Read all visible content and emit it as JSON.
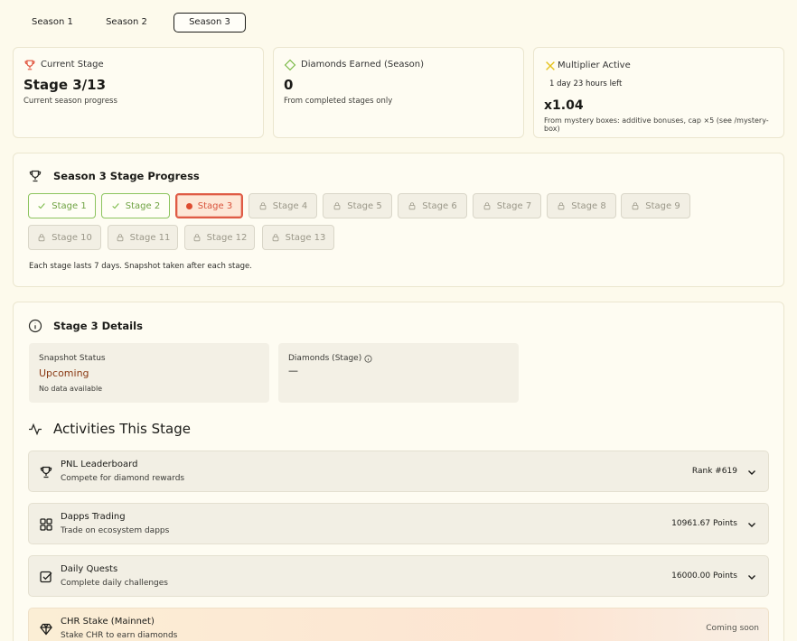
{
  "season_tabs": [
    "Season 1",
    "Season 2",
    "Season 3"
  ],
  "stats": {
    "current_stage": {
      "label": "Current Stage",
      "value": "Stage 3/13",
      "sub": "Current season progress",
      "icon": "trophy-icon",
      "color": "#e0513b"
    },
    "diamonds": {
      "label": "Diamonds Earned (Season)",
      "value": "0",
      "sub": "From completed stages only",
      "icon": "diamond-icon",
      "color": "#7dbb4b"
    },
    "multiplier": {
      "label": "Multiplier Active",
      "time_left": "1 day 23 hours left",
      "value": "x1.04",
      "sub": "From mystery boxes: additive bonuses, cap ×5 (see /mystery-box)",
      "icon": "sparkle-icon",
      "color": "#e6c21c"
    }
  },
  "progress": {
    "title": "Season 3 Stage Progress",
    "stages": [
      {
        "label": "Stage 1",
        "state": "done"
      },
      {
        "label": "Stage 2",
        "state": "done"
      },
      {
        "label": "Stage 3",
        "state": "current"
      },
      {
        "label": "Stage 4",
        "state": "locked"
      },
      {
        "label": "Stage 5",
        "state": "locked"
      },
      {
        "label": "Stage 6",
        "state": "locked"
      },
      {
        "label": "Stage 7",
        "state": "locked"
      },
      {
        "label": "Stage 8",
        "state": "locked"
      },
      {
        "label": "Stage 9",
        "state": "locked"
      },
      {
        "label": "Stage 10",
        "state": "locked"
      },
      {
        "label": "Stage 11",
        "state": "locked"
      },
      {
        "label": "Stage 12",
        "state": "locked"
      },
      {
        "label": "Stage 13",
        "state": "locked"
      }
    ],
    "note": "Each stage lasts 7 days. Snapshot taken after each stage."
  },
  "details": {
    "title": "Stage 3 Details",
    "snapshot": {
      "label": "Snapshot Status",
      "value": "Upcoming",
      "note": "No data available",
      "value_color": "#8a3a14"
    },
    "diamonds_stage": {
      "label": "Diamonds (Stage)",
      "value": "—"
    }
  },
  "activities": {
    "title": "Activities This Stage",
    "items": [
      {
        "title": "PNL Leaderboard",
        "sub": "Compete for diamond rewards",
        "value": "Rank #619",
        "icon": "trophy-icon"
      },
      {
        "title": "Dapps Trading",
        "sub": "Trade on ecosystem dapps",
        "value": "10961.67 Points",
        "icon": "grid-icon"
      },
      {
        "title": "Daily Quests",
        "sub": "Complete daily challenges",
        "value": "16000.00 Points",
        "icon": "checkbox-icon"
      },
      {
        "title": "CHR Stake (Mainnet)",
        "sub": "Stake CHR to earn diamonds",
        "value": "Coming soon",
        "icon": "diamond-icon"
      }
    ]
  }
}
